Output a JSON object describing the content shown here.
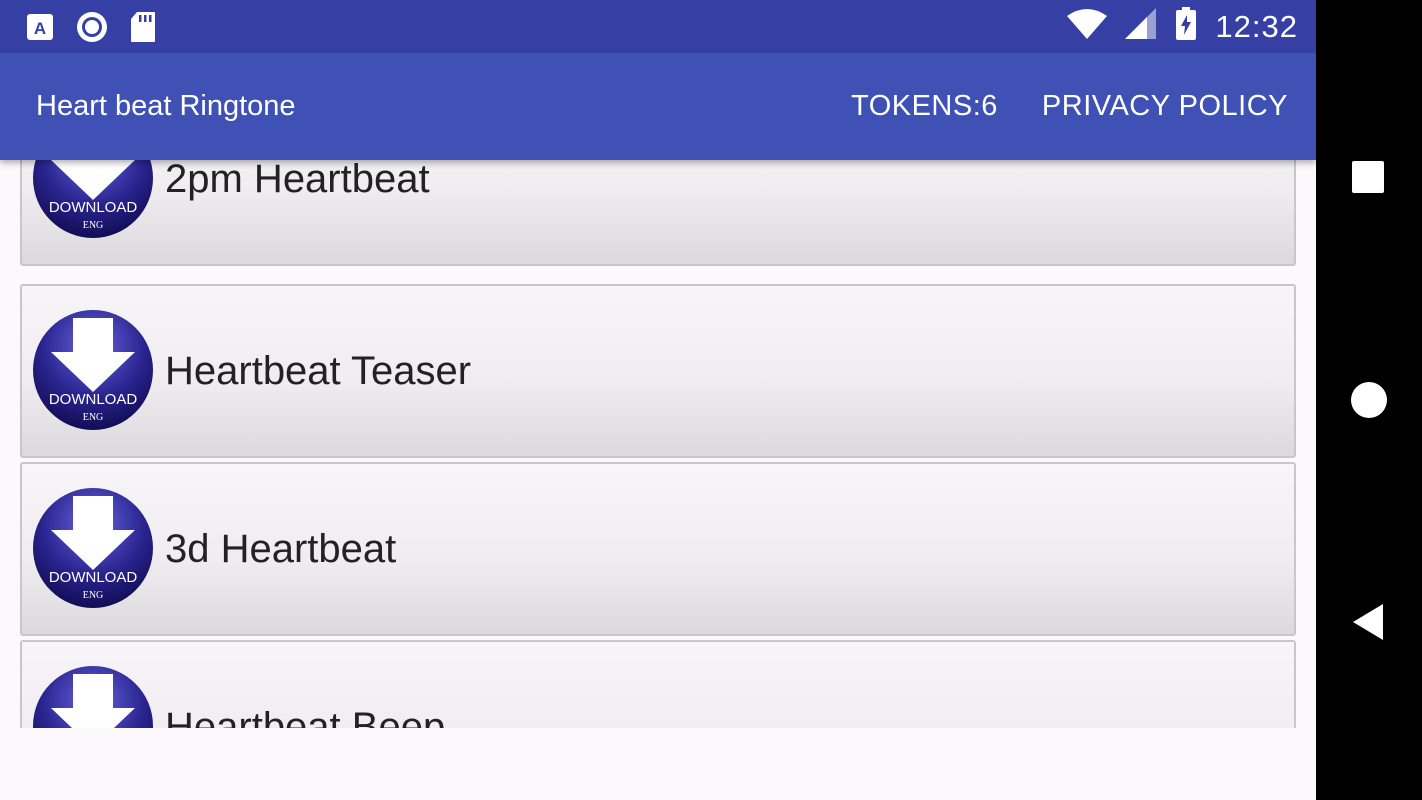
{
  "status_bar": {
    "time": "12:32",
    "left_icons": [
      "a-notification-icon",
      "record-icon",
      "sd-card-icon"
    ],
    "right_icons": [
      "wifi-icon",
      "signal-icon",
      "battery-charging-icon"
    ]
  },
  "app_bar": {
    "title": "Heart beat Ringtone",
    "tokens_label": "TOKENS:6",
    "privacy_label": "PRIVACY POLICY",
    "color": "#3f51b5",
    "status_color": "#3640a4"
  },
  "list": {
    "items": [
      {
        "title": "2pm Heartbeat",
        "icon": "download-icon"
      },
      {
        "title": "Heartbeat Teaser",
        "icon": "download-icon"
      },
      {
        "title": "3d Heartbeat",
        "icon": "download-icon"
      },
      {
        "title": "Heartbeat Beep",
        "icon": "download-icon"
      }
    ],
    "download_icon_text": "DOWNLOAD",
    "download_icon_subtext": "ENG"
  },
  "nav_bar": {
    "buttons": [
      "recents-button",
      "home-button",
      "back-button"
    ]
  }
}
